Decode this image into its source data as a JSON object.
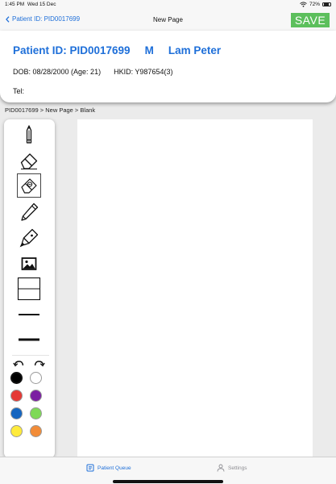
{
  "status_bar": {
    "time": "1:45 PM",
    "date": "Wed 15 Dec",
    "battery_text": "72%"
  },
  "nav": {
    "back_label": "Patient ID: PID0017699",
    "title": "New Page",
    "save_label": "SAVE"
  },
  "patient": {
    "id_label": "Patient ID: PID0017699",
    "gender": "M",
    "name": "Lam Peter",
    "dob": "DOB: 08/28/2000 (Age: 21)",
    "hkid": "HKID: Y987654(3)",
    "tel": "Tel:"
  },
  "breadcrumb": "PID0017699 > New Page > Blank",
  "toolbar": {
    "tools": [
      {
        "name": "pencil-tool",
        "icon": "pencil-icon"
      },
      {
        "name": "eraser-tool",
        "icon": "eraser-icon"
      },
      {
        "name": "area-eraser-tool",
        "icon": "area-eraser-icon",
        "selected": true
      },
      {
        "name": "pen-tool",
        "icon": "pen-icon"
      },
      {
        "name": "marker-tool",
        "icon": "marker-icon"
      },
      {
        "name": "image-tool",
        "icon": "image-icon"
      },
      {
        "name": "template-tool",
        "icon": "template-icon"
      },
      {
        "name": "thin-line-tool",
        "icon": "thin-line-icon"
      },
      {
        "name": "thick-line-tool",
        "icon": "thick-line-icon"
      }
    ],
    "undo_icon": "undo-icon",
    "redo_icon": "redo-icon",
    "colors": [
      {
        "name": "black",
        "hex": "#000000",
        "selected": true
      },
      {
        "name": "white",
        "hex": "#ffffff"
      },
      {
        "name": "red",
        "hex": "#e53935"
      },
      {
        "name": "purple",
        "hex": "#7b1fa2"
      },
      {
        "name": "blue",
        "hex": "#1565c0"
      },
      {
        "name": "green",
        "hex": "#7ed957"
      },
      {
        "name": "yellow",
        "hex": "#ffeb3b"
      },
      {
        "name": "orange",
        "hex": "#f28c38"
      }
    ]
  },
  "tabs": {
    "queue_label": "Patient Queue",
    "settings_label": "Settings"
  },
  "colors": {
    "accent": "#1e6fd9",
    "save_green": "#5cbf5c",
    "inactive_tab": "#8e8e93"
  }
}
